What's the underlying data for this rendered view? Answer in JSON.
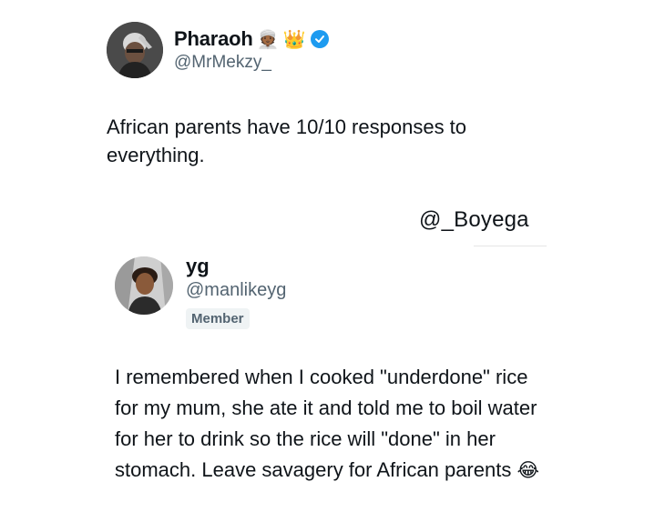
{
  "tweet": {
    "author": {
      "display_name": "Pharaoh",
      "emojis": [
        "👳🏾",
        "👑"
      ],
      "handle": "@MrMekzy_",
      "verified": true,
      "avatar_icon": "profile-photo"
    },
    "text": "African parents have 10/10 responses to everything."
  },
  "credit": "@_Boyega",
  "quoted_tweet": {
    "author": {
      "display_name": "yg",
      "handle": "@manlikeyg",
      "badge": "Member",
      "avatar_icon": "profile-photo"
    },
    "text": "I remembered when I cooked \"underdone\" rice for my mum, she ate it and told me to boil water for her to drink so the rice will \"done\" in her stomach. Leave savagery for African parents",
    "trailing_emoji": "😂"
  },
  "colors": {
    "text": "#0f1419",
    "secondary": "#536471",
    "verified_blue": "#1d9bf0",
    "badge_bg": "#eff3f4"
  }
}
